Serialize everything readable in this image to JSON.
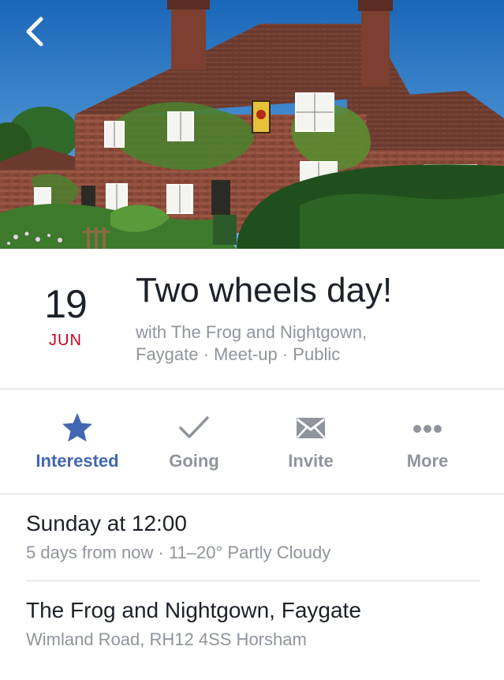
{
  "nav": {
    "back_icon": "chevron-left-icon"
  },
  "event": {
    "day": "19",
    "month": "JUN",
    "title": "Two wheels day!",
    "subtitle_line1": "with The Frog and Nightgown,",
    "subtitle_line2": "Faygate · Meet-up · Public"
  },
  "actions": [
    {
      "label": "Interested",
      "icon": "star-icon",
      "active": true
    },
    {
      "label": "Going",
      "icon": "checkmark-icon",
      "active": false
    },
    {
      "label": "Invite",
      "icon": "envelope-icon",
      "active": false
    },
    {
      "label": "More",
      "icon": "more-dots-icon",
      "active": false
    }
  ],
  "time": {
    "main": "Sunday at 12:00",
    "sub": "5 days from now · 11–20° Partly Cloudy"
  },
  "location": {
    "main": "The Frog and Nightgown, Faygate",
    "sub": "Wimland Road, RH12 4SS Horsham"
  },
  "colors": {
    "accent": "#4267b2",
    "month": "#c9001a",
    "secondary_text": "#90949c",
    "divider": "#d6d8dc"
  }
}
